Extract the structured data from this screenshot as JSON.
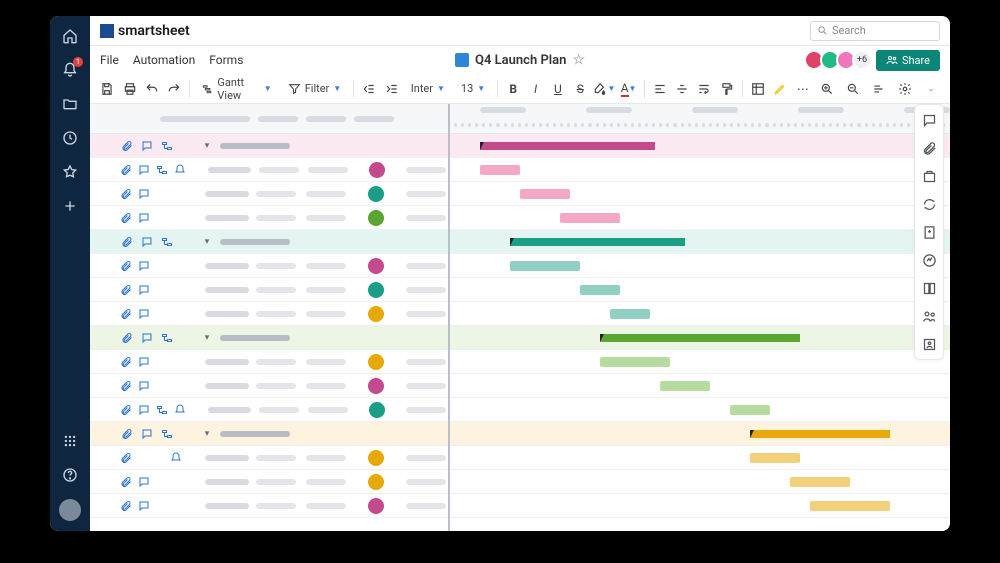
{
  "brand": "smartsheet",
  "search": {
    "placeholder": "Search"
  },
  "notifications_count": "1",
  "menu": {
    "file": "File",
    "automation": "Automation",
    "forms": "Forms"
  },
  "doc_title": "Q4 Launch Plan",
  "collab": {
    "more": "+6",
    "share": "Share"
  },
  "toolbar": {
    "view": "Gantt View",
    "filter": "Filter",
    "font": "Inter",
    "size": "13"
  },
  "groups": [
    {
      "color": "pink",
      "summary": {
        "start": 6,
        "len": 35
      },
      "tasks": [
        {
          "attach": true,
          "comment": true,
          "pred": true,
          "reminder": true,
          "assignee": "#c44a8e",
          "bar": {
            "start": 6,
            "len": 8
          }
        },
        {
          "attach": true,
          "comment": true,
          "assignee": "#1a9e85",
          "bar": {
            "start": 14,
            "len": 10
          }
        },
        {
          "attach": true,
          "comment": true,
          "assignee": "#5aa631",
          "bar": {
            "start": 22,
            "len": 12
          }
        }
      ]
    },
    {
      "color": "teal",
      "summary": {
        "start": 12,
        "len": 35
      },
      "tasks": [
        {
          "attach": true,
          "comment": true,
          "assignee": "#c44a8e",
          "bar": {
            "start": 12,
            "len": 14
          }
        },
        {
          "attach": true,
          "comment": true,
          "assignee": "#1a9e85",
          "bar": {
            "start": 26,
            "len": 8
          }
        },
        {
          "attach": true,
          "comment": true,
          "assignee": "#e8a80a",
          "bar": {
            "start": 32,
            "len": 8
          }
        }
      ]
    },
    {
      "color": "green",
      "summary": {
        "start": 30,
        "len": 40
      },
      "tasks": [
        {
          "attach": true,
          "comment": true,
          "assignee": "#e8a80a",
          "bar": {
            "start": 30,
            "len": 14
          }
        },
        {
          "attach": true,
          "comment": true,
          "assignee": "#c44a8e",
          "bar": {
            "start": 42,
            "len": 10
          }
        },
        {
          "attach": true,
          "comment": true,
          "pred": true,
          "reminder": true,
          "assignee": "#1a9e85",
          "bar": {
            "start": 56,
            "len": 8
          }
        }
      ]
    },
    {
      "color": "yellow",
      "summary": {
        "start": 60,
        "len": 28
      },
      "tasks": [
        {
          "attach": true,
          "reminder": true,
          "assignee": "#e8a80a",
          "bar": {
            "start": 60,
            "len": 10
          }
        },
        {
          "attach": true,
          "comment": true,
          "assignee": "#e8a80a",
          "bar": {
            "start": 68,
            "len": 12
          }
        },
        {
          "attach": true,
          "comment": true,
          "assignee": "#c44a8e",
          "bar": {
            "start": 72,
            "len": 16
          }
        }
      ]
    }
  ],
  "rightrail_icons": [
    "chat-icon",
    "link-icon",
    "briefcase-icon",
    "workflow-icon",
    "publish-icon",
    "activity-icon",
    "cellhistory-icon",
    "resource-icon",
    "critical-icon"
  ]
}
